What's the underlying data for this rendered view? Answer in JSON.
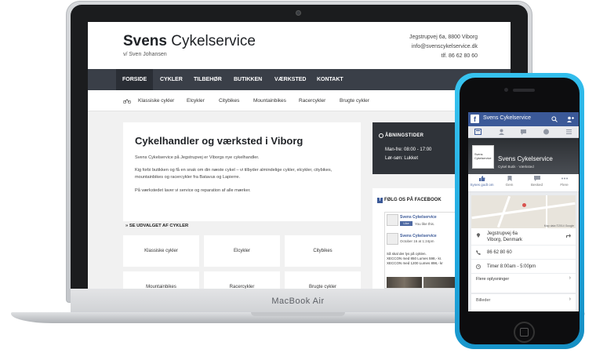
{
  "device_label": "MacBook Air",
  "site": {
    "brand_bold": "Svens",
    "brand_rest": " Cykelservice",
    "subtitle": "v/ Sven Johansen",
    "contact": [
      "Jegstrupvej 6a, 8800 Viborg",
      "info@svenscykelservice.dk",
      "tlf. 86 62 80 60"
    ],
    "nav": [
      {
        "label": "FORSIDE",
        "active": true
      },
      {
        "label": "CYKLER",
        "active": false
      },
      {
        "label": "TILBEHØR",
        "active": false
      },
      {
        "label": "BUTIKKEN",
        "active": false
      },
      {
        "label": "VÆRKSTED",
        "active": false
      },
      {
        "label": "KONTAKT",
        "active": false
      }
    ],
    "subnav": [
      "Klassiske cykler",
      "Elcykler",
      "Citybikes",
      "Mountainbikes",
      "Racercykler",
      "Brugte cykler"
    ],
    "main_title": "Cykelhandler og værksted i Viborg",
    "paragraphs": [
      "Svens Cykelservice på Jegstrupvej er Viborgs nye cykelhandler.",
      "Kig forbi butikken og få en snak om din næste cykel – vi tilbyder almindelige cykler, elcykler, citybikes, mountainbikes og racercykler fra Batavus og Lapierre.",
      "På værkstedet laver vi service og reparation af alle mærker."
    ],
    "see_label": "SE UDVALGET AF CYKLER",
    "categories": [
      "Klassiske cykler",
      "Elcykler",
      "Citybikes",
      "Mountainbikes",
      "Racercykler",
      "Brugte cykler"
    ],
    "hours": {
      "title": "ÅBNINGSTIDER",
      "lines": [
        "Man-fre: 08:00 - 17:00",
        "Lør-søn: Lukket"
      ]
    },
    "facebook": {
      "title": "FØLG OS PÅ FACEBOOK",
      "page_name": "Svens Cykelservice",
      "like": "Like",
      "likes_text": "You like this.",
      "post_name": "Svens Cykelservice",
      "post_date": "October 16 at 1:24pm",
      "post_lines": [
        "Så skal der lys på cyklen.",
        "XECCON med 850 Lumes 598,- kr.",
        "XECCON med 1200 Lumes 898,- kr"
      ]
    }
  },
  "phone": {
    "topbar_title": "Svens Cykelservice",
    "profile_pic_text": "Svens Cykelservice",
    "page_name": "Svens Cykelservice",
    "page_category": "Cykel Butik · Værksted",
    "actions": [
      "Synes godt om",
      "Gem",
      "Besked",
      "Flere"
    ],
    "map_credit": "Map data ©2014 Google",
    "address_lines": [
      "Jegstrupvej 6a",
      "Viborg, Denmark"
    ],
    "phone_number": "86 62 80 60",
    "hours": "Timer 8:00am - 5:00pm",
    "more_info": "Flere oplysninger",
    "photos": "Billeder"
  },
  "colors": {
    "nav_bg": "#3a3f48",
    "facebook_blue": "#3b5998",
    "phone_body": "#1ea6de"
  }
}
